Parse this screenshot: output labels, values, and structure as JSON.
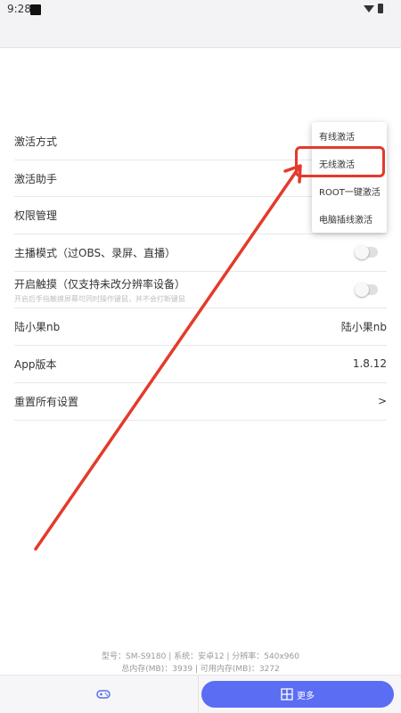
{
  "status_bar": {
    "time": "9:28",
    "icons": [
      "notification-square-icon",
      "wifi-icon",
      "battery-icon"
    ]
  },
  "settings": {
    "activation_mode": "激活方式",
    "activation_helper": "激活助手",
    "permission_management": "权限管理",
    "streamer_mode": "主播模式（过OBS、录屏、直播）",
    "enable_touch": "开启触摸（仅支持未改分辨率设备）",
    "enable_touch_note": "开启后手指触摸屏幕可同时操作键鼠，并不会打断键鼠",
    "user_label": "陆小果nb",
    "user_value": "陆小果nb",
    "app_version_label": "App版本",
    "app_version_value": "1.8.12",
    "reset_all": "重置所有设置",
    "reset_arrow": ">"
  },
  "activation_menu": {
    "items": [
      "有线激活",
      "无线激活",
      "ROOT一键激活",
      "电脑插线激活"
    ],
    "highlighted": "无线激活"
  },
  "device_info": {
    "line1": "型号：SM-S9180 | 系统：安卓12 | 分辨率：540x960",
    "line2": "总内存(MB)：3939 | 可用内存(MB)：3272"
  },
  "bottom_nav": {
    "left_icon": "gamepad-icon",
    "more_icon": "grid-icon",
    "more_label": "更多"
  },
  "colors": {
    "accent": "#5b6df2",
    "annotation": "#e43a2b"
  }
}
